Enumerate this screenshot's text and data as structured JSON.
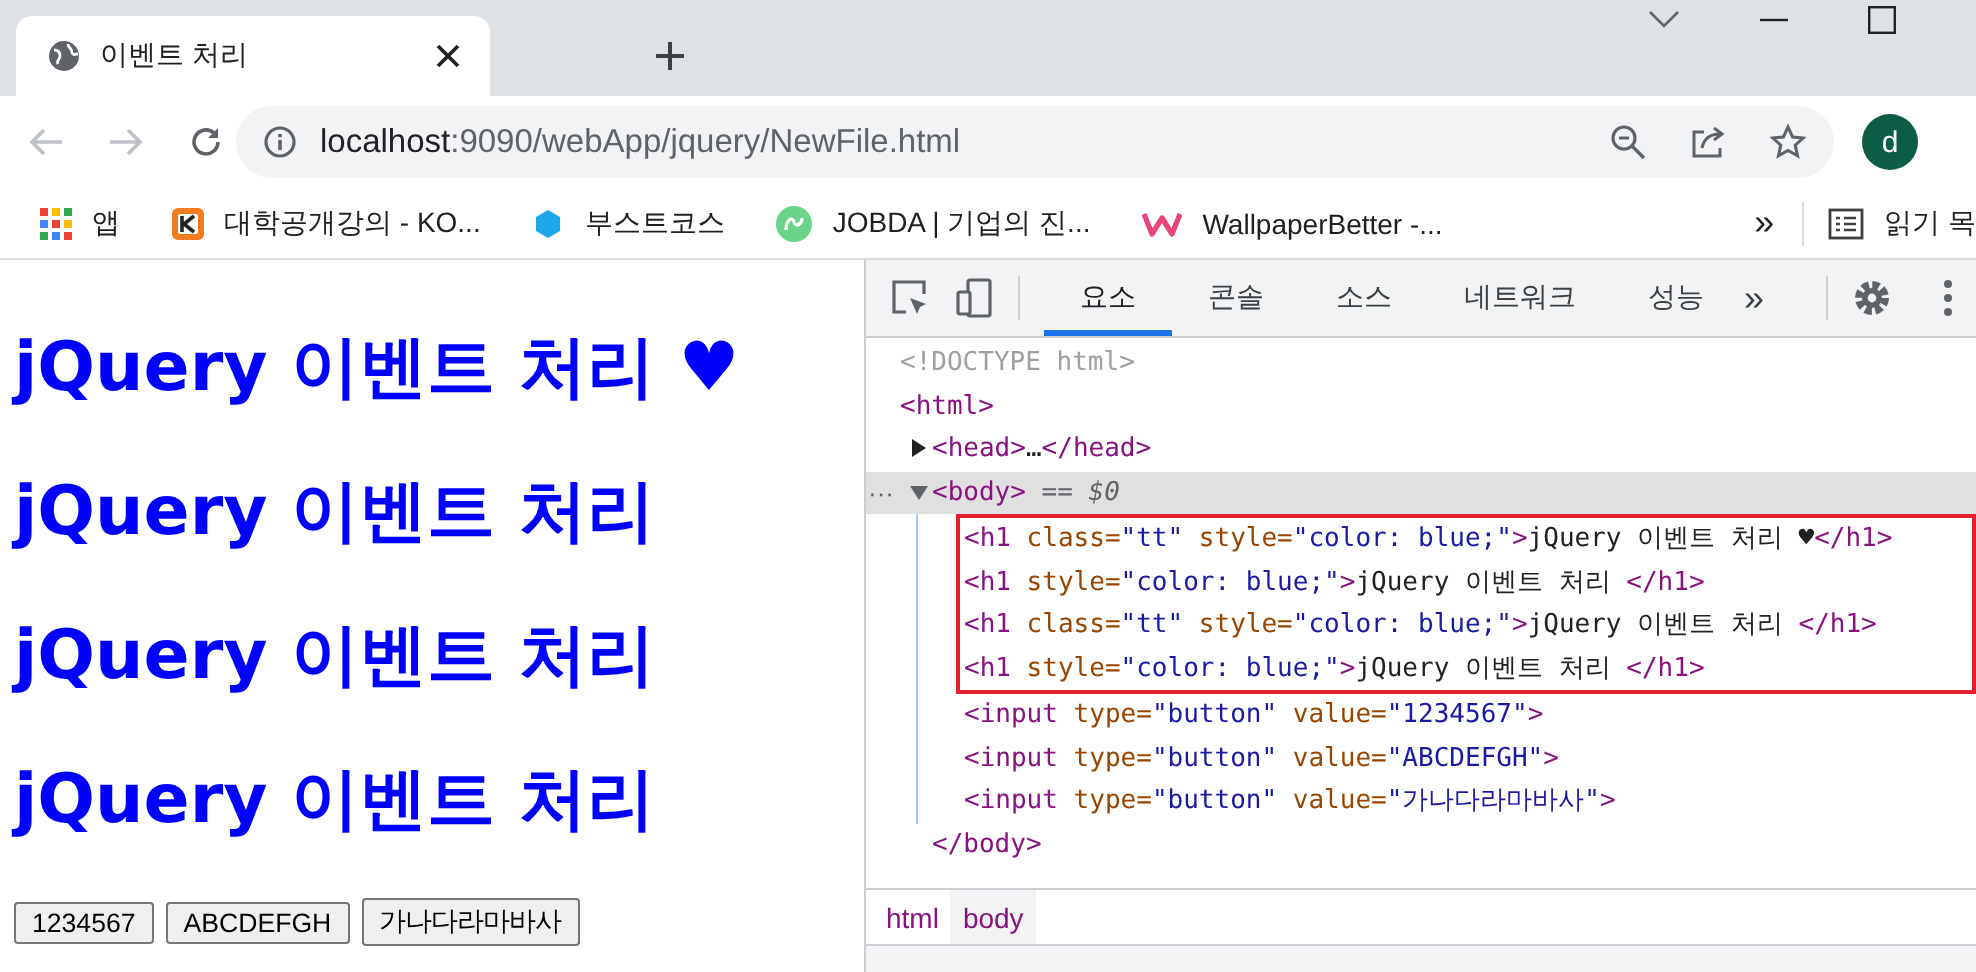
{
  "browser": {
    "tab": {
      "title": "이벤트 처리"
    },
    "address": {
      "host": "localhost",
      "path": ":9090/webApp/jquery/NewFile.html"
    },
    "profile": {
      "initial": "d"
    },
    "bookmarks": [
      {
        "kind": "apps",
        "label": "앱"
      },
      {
        "kind": "k",
        "label": "대학공개강의 - KO..."
      },
      {
        "kind": "boost",
        "label": "부스트코스"
      },
      {
        "kind": "jobda",
        "label": "JOBDA | 기업의 진..."
      },
      {
        "kind": "w",
        "label": "WallpaperBetter -..."
      }
    ],
    "bookmarks_overflow": "»",
    "reading_list": "읽기 목"
  },
  "page": {
    "headings": [
      {
        "text": "jQuery 이벤트 처리 ♥"
      },
      {
        "text": "jQuery 이벤트 처리"
      },
      {
        "text": "jQuery 이벤트 처리"
      },
      {
        "text": "jQuery 이벤트 처리"
      }
    ],
    "buttons": [
      "1234567",
      "ABCDEFGH",
      "가나다라마바사"
    ]
  },
  "devtools": {
    "tabs": [
      {
        "label": "요소",
        "selected": true
      },
      {
        "label": "콘솔",
        "selected": false
      },
      {
        "label": "소스",
        "selected": false
      },
      {
        "label": "네트워크",
        "selected": false
      },
      {
        "label": "성능",
        "selected": false
      }
    ],
    "tabs_overflow": "»",
    "selection_marker": "···",
    "dom_tree": [
      {
        "selected": false,
        "tokens": [
          {
            "kind": "doctype",
            "text": "<!DOCTYPE html>"
          }
        ]
      },
      {
        "selected": false,
        "tokens": [
          {
            "kind": "tag",
            "text": "<html>"
          }
        ],
        "children": [
          {
            "selected": false,
            "expanded": false,
            "tokens": [
              {
                "kind": "tag",
                "text": "<head>"
              },
              {
                "kind": "text",
                "text": "…"
              },
              {
                "kind": "tag",
                "text": "</head>"
              }
            ]
          },
          {
            "selected": true,
            "expanded": true,
            "tokens": [
              {
                "kind": "tag",
                "text": "<body>"
              },
              {
                "kind": "ref",
                "text": " == $0"
              }
            ],
            "closing": [
              {
                "kind": "tag",
                "text": "</body>"
              }
            ],
            "children": [
              {
                "selected": false,
                "outlined": true,
                "tokens": [
                  {
                    "kind": "tag",
                    "text": "<h1"
                  },
                  {
                    "kind": "attr",
                    "text": " class="
                  },
                  {
                    "kind": "value",
                    "text": "\"tt\""
                  },
                  {
                    "kind": "attr",
                    "text": " style="
                  },
                  {
                    "kind": "value",
                    "text": "\"color: blue;\""
                  },
                  {
                    "kind": "tag",
                    "text": ">"
                  },
                  {
                    "kind": "text",
                    "text": "jQuery 이벤트 처리 ♥"
                  },
                  {
                    "kind": "tag",
                    "text": "</h1>"
                  }
                ]
              },
              {
                "selected": false,
                "outlined": true,
                "tokens": [
                  {
                    "kind": "tag",
                    "text": "<h1"
                  },
                  {
                    "kind": "attr",
                    "text": " style="
                  },
                  {
                    "kind": "value",
                    "text": "\"color: blue;\""
                  },
                  {
                    "kind": "tag",
                    "text": ">"
                  },
                  {
                    "kind": "text",
                    "text": "jQuery 이벤트 처리"
                  },
                  {
                    "kind": "tag",
                    "text": " </h1>"
                  }
                ]
              },
              {
                "selected": false,
                "outlined": true,
                "tokens": [
                  {
                    "kind": "tag",
                    "text": "<h1"
                  },
                  {
                    "kind": "attr",
                    "text": " class="
                  },
                  {
                    "kind": "value",
                    "text": "\"tt\""
                  },
                  {
                    "kind": "attr",
                    "text": " style="
                  },
                  {
                    "kind": "value",
                    "text": "\"color: blue;\""
                  },
                  {
                    "kind": "tag",
                    "text": ">"
                  },
                  {
                    "kind": "text",
                    "text": "jQuery 이벤트 처리"
                  },
                  {
                    "kind": "tag",
                    "text": " </h1>"
                  }
                ]
              },
              {
                "selected": false,
                "outlined": true,
                "tokens": [
                  {
                    "kind": "tag",
                    "text": "<h1"
                  },
                  {
                    "kind": "attr",
                    "text": " style="
                  },
                  {
                    "kind": "value",
                    "text": "\"color: blue;\""
                  },
                  {
                    "kind": "tag",
                    "text": ">"
                  },
                  {
                    "kind": "text",
                    "text": "jQuery 이벤트 처리"
                  },
                  {
                    "kind": "tag",
                    "text": " </h1>"
                  }
                ]
              },
              {
                "selected": false,
                "outlined": false,
                "tokens": [
                  {
                    "kind": "tag",
                    "text": "<input"
                  },
                  {
                    "kind": "attr",
                    "text": " type="
                  },
                  {
                    "kind": "value",
                    "text": "\"button\""
                  },
                  {
                    "kind": "attr",
                    "text": " value="
                  },
                  {
                    "kind": "value",
                    "text": "\"1234567\""
                  },
                  {
                    "kind": "tag",
                    "text": ">"
                  }
                ]
              },
              {
                "selected": false,
                "outlined": false,
                "tokens": [
                  {
                    "kind": "tag",
                    "text": "<input"
                  },
                  {
                    "kind": "attr",
                    "text": " type="
                  },
                  {
                    "kind": "value",
                    "text": "\"button\""
                  },
                  {
                    "kind": "attr",
                    "text": " value="
                  },
                  {
                    "kind": "value",
                    "text": "\"ABCDEFGH\""
                  },
                  {
                    "kind": "tag",
                    "text": ">"
                  }
                ]
              },
              {
                "selected": false,
                "outlined": false,
                "tokens": [
                  {
                    "kind": "tag",
                    "text": "<input"
                  },
                  {
                    "kind": "attr",
                    "text": " type="
                  },
                  {
                    "kind": "value",
                    "text": "\"button\""
                  },
                  {
                    "kind": "attr",
                    "text": " value="
                  },
                  {
                    "kind": "value",
                    "text": "\"가나다라마바사\""
                  },
                  {
                    "kind": "tag",
                    "text": ">"
                  }
                ]
              }
            ]
          }
        ]
      }
    ],
    "breadcrumbs": [
      {
        "label": "html",
        "selected": false
      },
      {
        "label": "body",
        "selected": true
      }
    ]
  }
}
